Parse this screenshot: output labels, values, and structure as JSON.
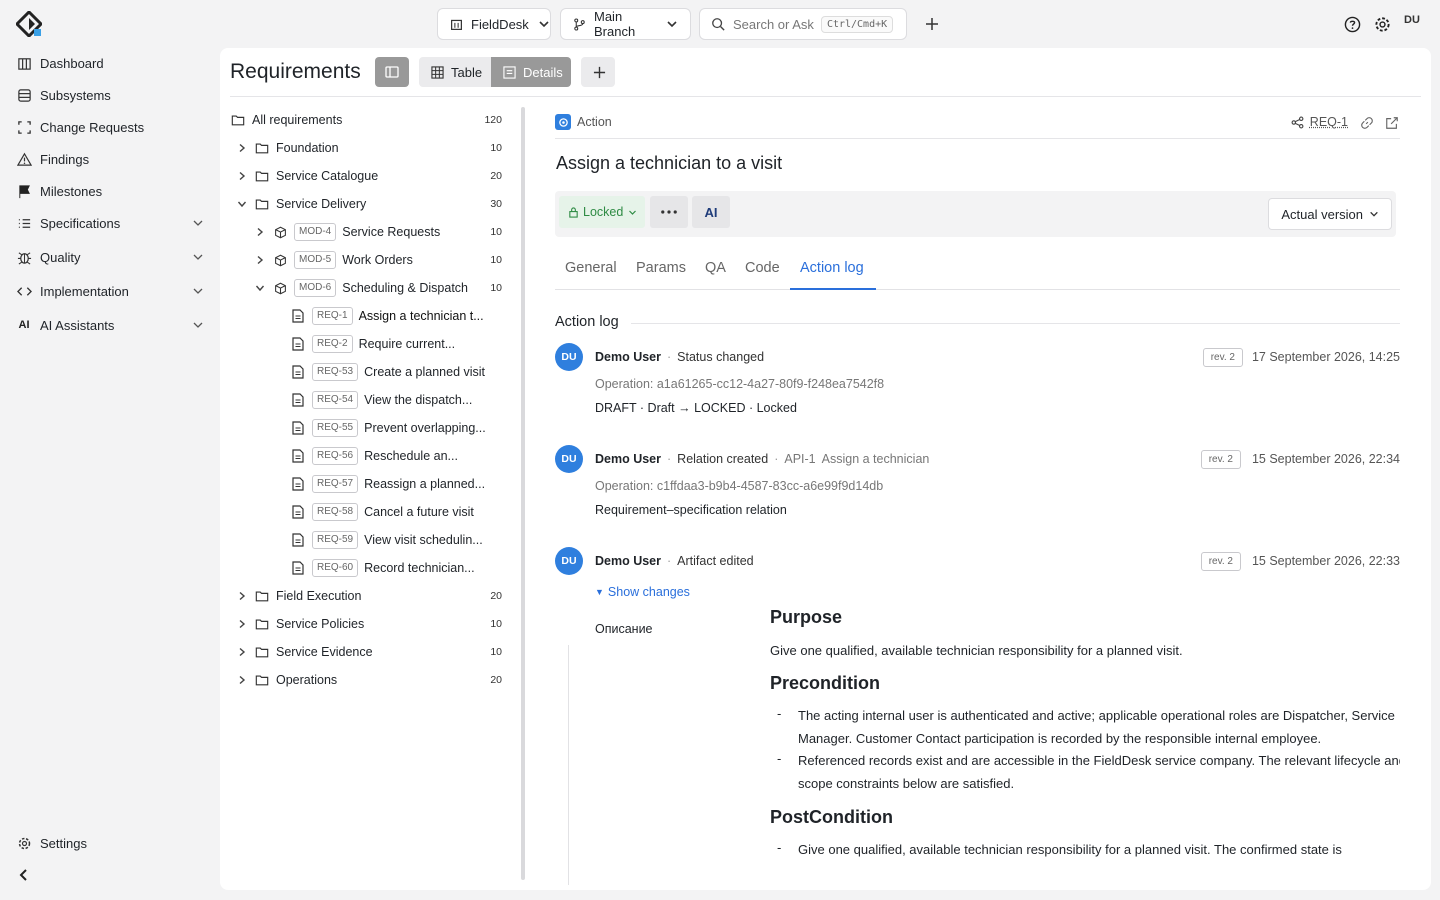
{
  "topbar": {
    "workspace": "FieldDesk",
    "branch": "Main Branch",
    "search_placeholder": "Search or Ask",
    "search_shortcut": "Ctrl/Cmd+K",
    "user_initials": "DU"
  },
  "sidebar": {
    "items": [
      {
        "label": "Dashboard"
      },
      {
        "label": "Subsystems"
      },
      {
        "label": "Change Requests"
      },
      {
        "label": "Findings"
      },
      {
        "label": "Milestones"
      },
      {
        "label": "Specifications"
      },
      {
        "label": "Quality"
      },
      {
        "label": "Implementation"
      },
      {
        "label": "AI Assistants"
      }
    ],
    "settings_label": "Settings"
  },
  "header": {
    "title": "Requirements",
    "view_table": "Table",
    "view_details": "Details"
  },
  "tree": {
    "root": {
      "label": "All requirements",
      "count": "120"
    },
    "rows": [
      {
        "label": "Foundation",
        "count": "10"
      },
      {
        "label": "Service Catalogue",
        "count": "20"
      },
      {
        "label": "Service Delivery",
        "count": "30"
      },
      {
        "tag": "MOD-4",
        "label": "Service Requests",
        "count": "10"
      },
      {
        "tag": "MOD-5",
        "label": "Work Orders",
        "count": "10"
      },
      {
        "tag": "MOD-6",
        "label": "Scheduling & Dispatch",
        "count": "10"
      },
      {
        "tag": "REQ-1",
        "label": "Assign a technician t..."
      },
      {
        "tag": "REQ-2",
        "label": "Require current..."
      },
      {
        "tag": "REQ-53",
        "label": "Create a planned visit"
      },
      {
        "tag": "REQ-54",
        "label": "View the dispatch..."
      },
      {
        "tag": "REQ-55",
        "label": "Prevent overlapping..."
      },
      {
        "tag": "REQ-56",
        "label": "Reschedule an..."
      },
      {
        "tag": "REQ-57",
        "label": "Reassign a planned..."
      },
      {
        "tag": "REQ-58",
        "label": "Cancel a future visit"
      },
      {
        "tag": "REQ-59",
        "label": "View visit schedulin..."
      },
      {
        "tag": "REQ-60",
        "label": "Record technician..."
      },
      {
        "label": "Field Execution",
        "count": "20"
      },
      {
        "label": "Service Policies",
        "count": "10"
      },
      {
        "label": "Service Evidence",
        "count": "10"
      },
      {
        "label": "Operations",
        "count": "20"
      }
    ]
  },
  "detail": {
    "kind": "Action",
    "id": "REQ-1",
    "title": "Assign a technician to a visit",
    "status": "Locked",
    "ai_label": "AI",
    "version_select": "Actual version",
    "tabs": [
      "General",
      "Params",
      "QA",
      "Code",
      "Action log"
    ],
    "section_title": "Action log"
  },
  "log": [
    {
      "user": "Demo User",
      "action": "Status changed",
      "rev": "rev. 2",
      "date": "17 September 2026, 14:25",
      "operation": "Operation: a1a61265-cc12-4a27-80f9-f248ea7542f8",
      "text": "DRAFT · Draft → LOCKED · Locked"
    },
    {
      "user": "Demo User",
      "action": "Relation created",
      "link_id": "API-1",
      "link_label": "Assign a technician",
      "rev": "rev. 2",
      "date": "15 September 2026, 22:34",
      "operation": "Operation: c1ffdaa3-b9b4-4587-83cc-a6e99f9d14db",
      "text": "Requirement–specification relation"
    },
    {
      "user": "Demo User",
      "action": "Artifact edited",
      "rev": "rev. 2",
      "date": "15 September 2026, 22:33",
      "show_changes": "Show changes",
      "field_label": "Описание"
    }
  ],
  "description": {
    "purpose_h": "Purpose",
    "purpose_p": "Give one qualified, available technician responsibility for a planned visit.",
    "pre_h": "Precondition",
    "pre_items": [
      "The acting internal user is authenticated and active; applicable operational roles are Dispatcher, Service Manager. Customer Contact participation is recorded by the responsible internal employee.",
      "Referenced records exist and are accessible in the FieldDesk service company. The relevant lifecycle and scope constraints below are satisfied."
    ],
    "post_h": "PostCondition",
    "post_items": [
      "Give one qualified, available technician responsibility for a planned visit. The confirmed state is"
    ]
  }
}
